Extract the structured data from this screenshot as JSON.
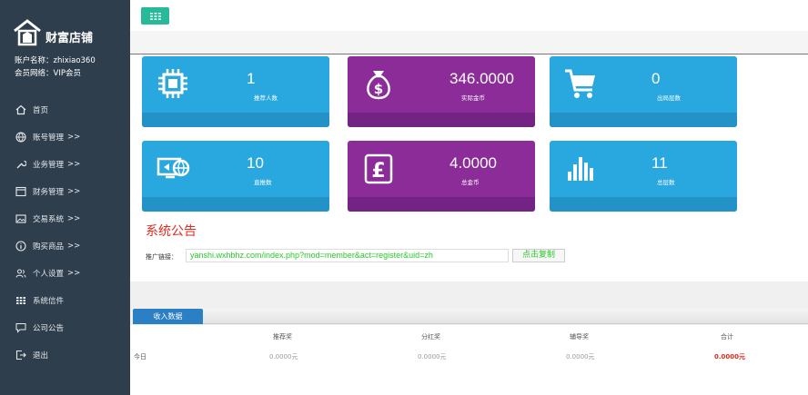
{
  "sidebar": {
    "logo_text": "财富店铺",
    "account_name_label": "账户名称：",
    "account_name_value": "zhixiao360",
    "member_level_label": "会员网络：",
    "member_level_value": "VIP会员",
    "items": [
      {
        "label": "首页",
        "icon": "home-icon",
        "arrow": ""
      },
      {
        "label": "账号管理",
        "icon": "globe-icon",
        "arrow": ">>"
      },
      {
        "label": "业务管理",
        "icon": "wrench-icon",
        "arrow": ">>"
      },
      {
        "label": "财务管理",
        "icon": "window-icon",
        "arrow": ">>"
      },
      {
        "label": "交易系统",
        "icon": "image-icon",
        "arrow": ">>"
      },
      {
        "label": "购买商品",
        "icon": "info-icon",
        "arrow": ">>"
      },
      {
        "label": "个人设置",
        "icon": "users-icon",
        "arrow": ">>"
      },
      {
        "label": "系统信件",
        "icon": "grid-icon",
        "arrow": ""
      },
      {
        "label": "公司公告",
        "icon": "comment-icon",
        "arrow": ""
      },
      {
        "label": "退出",
        "icon": "logout-icon",
        "arrow": ""
      }
    ]
  },
  "cards": [
    {
      "value": "1",
      "label": "推荐人数",
      "icon": "chip-icon",
      "color": "#29a8e0"
    },
    {
      "value": "346.0000",
      "label": "实际金币",
      "icon": "money-bag-icon",
      "color": "#8b2c99"
    },
    {
      "value": "0",
      "label": "出局层数",
      "icon": "cart-icon",
      "color": "#29a8e0"
    },
    {
      "value": "10",
      "label": "直推数",
      "icon": "screen-globe-icon",
      "color": "#29a8e0"
    },
    {
      "value": "4.0000",
      "label": "总金币",
      "icon": "pound-icon",
      "color": "#8b2c99"
    },
    {
      "value": "11",
      "label": "总层数",
      "icon": "bar-chart-icon",
      "color": "#29a8e0"
    }
  ],
  "notice": {
    "title": "系统公告",
    "promo_label": "推广链接：",
    "promo_link": "yanshi.wxhbhz.com/index.php?mod=member&act=register&uid=zh",
    "copy_button": "点击复制"
  },
  "income": {
    "tab_label": "收入数据",
    "headers": [
      "推荐奖",
      "分红奖",
      "辅导奖",
      "合计"
    ],
    "row_label": "今日",
    "values": [
      "0.0000元",
      "0.0000元",
      "0.0000元",
      "0.0000元"
    ]
  }
}
